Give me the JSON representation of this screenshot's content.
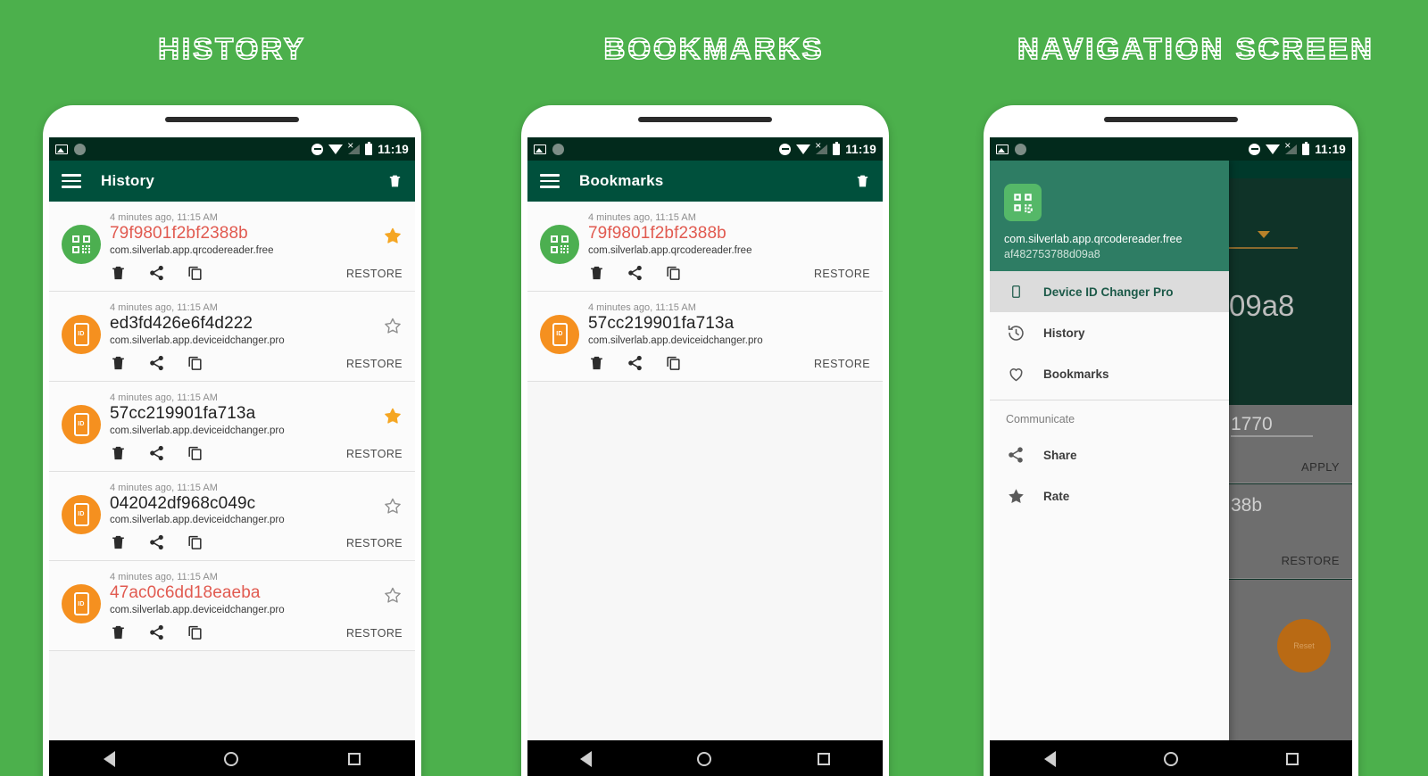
{
  "panels": [
    {
      "title": "HISTORY"
    },
    {
      "title": "BOOKMARKS"
    },
    {
      "title": "NAVIGATION SCREEN"
    }
  ],
  "colors": {
    "background_green": "#4cb04c",
    "statusbar": "#022a1c",
    "toolbar": "#00503c",
    "accent_red": "#e15a50",
    "accent_orange": "#f5901f",
    "accent_green": "#4caf50",
    "star_gold": "#f5a623",
    "drawer_header": "#2e7d64"
  },
  "statusbar": {
    "clock": "11:19",
    "icons": [
      "image-icon",
      "circle-icon",
      "do-not-disturb-icon",
      "wifi-icon",
      "signal-off-icon",
      "battery-icon"
    ]
  },
  "navbar": {
    "back": "back-icon",
    "home": "home-icon",
    "recents": "recents-icon"
  },
  "history": {
    "toolbar": {
      "menu_icon": "hamburger-icon",
      "title": "History",
      "delete_icon": "trash-icon"
    },
    "restore_label": "RESTORE",
    "items": [
      {
        "timestamp": "4 minutes ago, 11:15 AM",
        "hash": "79f9801f2bf2388b",
        "package": "com.silverlab.app.qrcodereader.free",
        "highlighted": true,
        "avatar": "qr-icon",
        "avatar_color": "green",
        "starred": true
      },
      {
        "timestamp": "4 minutes ago, 11:15 AM",
        "hash": "ed3fd426e6f4d222",
        "package": "com.silverlab.app.deviceidchanger.pro",
        "highlighted": false,
        "avatar": "device-id-icon",
        "avatar_color": "orange",
        "starred": false
      },
      {
        "timestamp": "4 minutes ago, 11:15 AM",
        "hash": "57cc219901fa713a",
        "package": "com.silverlab.app.deviceidchanger.pro",
        "highlighted": false,
        "avatar": "device-id-icon",
        "avatar_color": "orange",
        "starred": true
      },
      {
        "timestamp": "4 minutes ago, 11:15 AM",
        "hash": "042042df968c049c",
        "package": "com.silverlab.app.deviceidchanger.pro",
        "highlighted": false,
        "avatar": "device-id-icon",
        "avatar_color": "orange",
        "starred": false
      },
      {
        "timestamp": "4 minutes ago, 11:15 AM",
        "hash": "47ac0c6dd18eaeba",
        "package": "com.silverlab.app.deviceidchanger.pro",
        "highlighted": true,
        "avatar": "device-id-icon",
        "avatar_color": "orange",
        "starred": false
      }
    ]
  },
  "bookmarks": {
    "toolbar": {
      "menu_icon": "hamburger-icon",
      "title": "Bookmarks",
      "delete_icon": "trash-icon"
    },
    "restore_label": "RESTORE",
    "items": [
      {
        "timestamp": "4 minutes ago, 11:15 AM",
        "hash": "79f9801f2bf2388b",
        "package": "com.silverlab.app.qrcodereader.free",
        "highlighted": true,
        "avatar": "qr-icon",
        "avatar_color": "green"
      },
      {
        "timestamp": "4 minutes ago, 11:15 AM",
        "hash": "57cc219901fa713a",
        "package": "com.silverlab.app.deviceidchanger.pro",
        "highlighted": false,
        "avatar": "device-id-icon",
        "avatar_color": "orange"
      }
    ]
  },
  "navigation": {
    "drawer": {
      "app_icon": "qr-code-icon",
      "package": "com.silverlab.app.qrcodereader.free",
      "device_id": "af482753788d09a8",
      "items": [
        {
          "label": "Device ID Changer Pro",
          "icon": "phone-icon",
          "selected": true
        },
        {
          "label": "History",
          "icon": "history-clock-icon",
          "selected": false
        },
        {
          "label": "Bookmarks",
          "icon": "heart-icon",
          "selected": false
        }
      ],
      "section_label": "Communicate",
      "communicate_items": [
        {
          "label": "Share",
          "icon": "share-icon"
        },
        {
          "label": "Rate",
          "icon": "star-icon"
        }
      ]
    },
    "background": {
      "partial_hash": "09a8",
      "partial_value": "1770",
      "apply_label": "APPLY",
      "partial_hash2": "38b",
      "restore_label": "RESTORE",
      "fab_label": "Reset"
    }
  }
}
